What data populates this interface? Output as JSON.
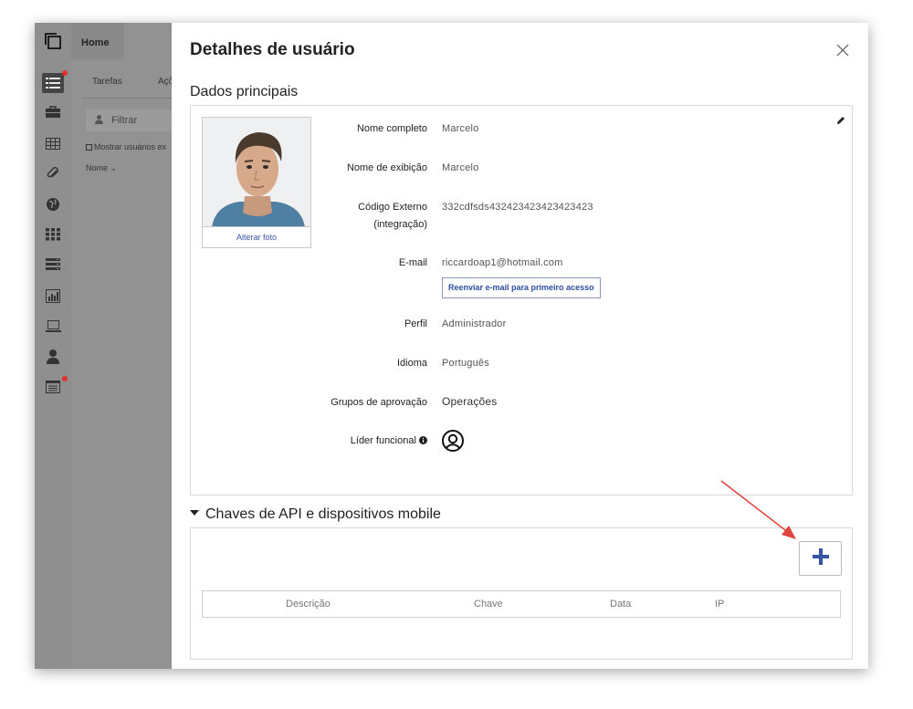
{
  "background_app": {
    "home_tab": "Home",
    "tabs": [
      "Tarefas",
      "Açõ"
    ],
    "filter_placeholder": "Filtrar",
    "show_users_checkbox": "Mostrar usuários ex",
    "name_column": "Nome"
  },
  "sidebar": {
    "icons": [
      "list-icon",
      "briefcase-icon",
      "table-icon",
      "paperclip-icon",
      "globe-icon",
      "apps-grid-icon",
      "stack-icon",
      "bar-chart-icon",
      "laptop-icon",
      "user-icon",
      "calendar-icon"
    ],
    "notification_color": "#e0302b"
  },
  "panel": {
    "title": "Detalhes de usuário",
    "main_section_title": "Dados principais",
    "change_photo_button": "Alterar foto",
    "fields": {
      "full_name_label": "Nome completo",
      "full_name_value": "Marcelo",
      "display_name_label": "Nome de exibição",
      "display_name_value": "Marcelo",
      "external_code_label_1": "Código Externo",
      "external_code_label_2": "(integração)",
      "external_code_value": "332cdfsds432423423423423423",
      "email_label": "E-mail",
      "email_value": "riccardoap1@hotmail.com",
      "resend_button": "Reenviar e-mail para primeiro acesso",
      "profile_label": "Perfil",
      "profile_value": "Administrador",
      "language_label": "Idioma",
      "language_value": "Português",
      "approval_groups_label": "Grupos de aprovação",
      "approval_groups_value": "Operações",
      "functional_leader_label": "Líder funcional"
    },
    "api_section_title": "Chaves de API e dispositivos mobile",
    "api_table_headers": [
      "Descrição",
      "Chave",
      "Data",
      "IP"
    ]
  },
  "colors": {
    "accent_blue": "#3555a5",
    "annotation_arrow": "#e2453f"
  }
}
